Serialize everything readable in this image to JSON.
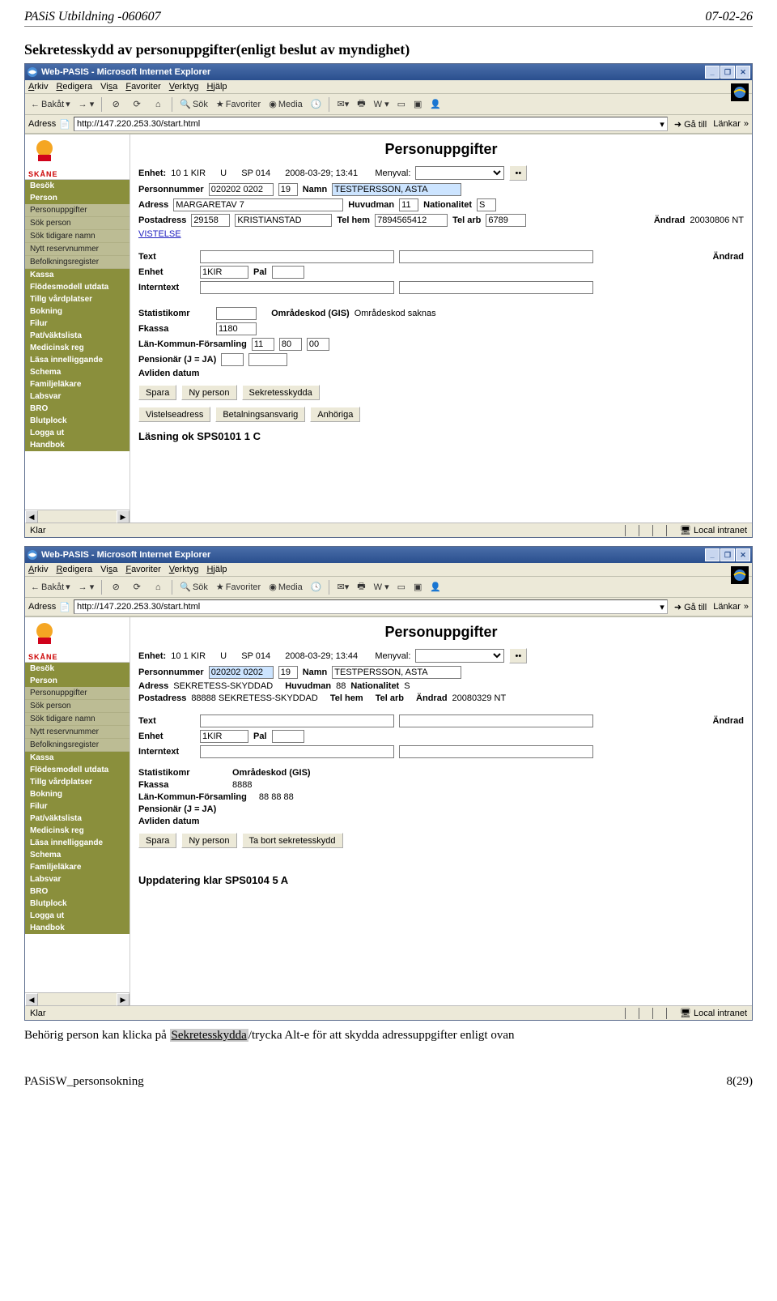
{
  "doc": {
    "header_left": "PASiS Utbildning -060607",
    "header_right": "07-02-26",
    "title": "Sekretesskydd av personuppgifter(enligt beslut av myndighet)",
    "body_1": "Behörig person kan klicka på ",
    "body_shaded": "Sekretesskydda",
    "body_2": "/trycka Alt-e för att skydda adressuppgifter enligt ovan",
    "footer_left": "PASiSW_personsokning",
    "footer_right": "8(29)"
  },
  "win1": {
    "title": "Web-PASIS - Microsoft Internet Explorer",
    "menu": [
      "Arkiv",
      "Redigera",
      "Visa",
      "Favoriter",
      "Verktyg",
      "Hjälp"
    ],
    "tb_back": "Bakåt",
    "tb_sok": "Sök",
    "tb_fav": "Favoriter",
    "tb_media": "Media",
    "addr_lbl": "Adress",
    "addr": "http://147.220.253.30/start.html",
    "go": "Gå till",
    "lankar": "Länkar",
    "logo": "SKÅNE",
    "nav_heads": [
      "Besök",
      "Person",
      "Kassa",
      "Flödesmodell utdata",
      "Tillg vårdplatser",
      "Bokning",
      "Filur",
      "Pat/väktslista",
      "Medicinsk reg",
      "Läsa innelliggande",
      "Schema",
      "Familjeläkare",
      "Labsvar",
      "BRO",
      "Blutplock",
      "Logga ut",
      "Handbok"
    ],
    "nav_items_person": [
      "Personuppgifter",
      "Sök person",
      "Sök tidigare namn",
      "Nytt reservnummer",
      "Befolkningsregister"
    ],
    "heading": "Personuppgifter",
    "enhet_lbl": "Enhet:",
    "enhet": "10 1 KIR",
    "enhet_u": "U",
    "sp": "SP 014",
    "dt": "2008-03-29; 13:41",
    "menyval": "Menyval:",
    "pn_lbl": "Personnummer",
    "pn": "020202 0202",
    "pn2": "19",
    "namn_lbl": "Namn",
    "namn": "TESTPERSSON, ASTA",
    "adr_lbl": "Adress",
    "adr": "MARGARETAV 7",
    "huvudman_lbl": "Huvudman",
    "huvudman": "11",
    "nat_lbl": "Nationalitet",
    "nat": "S",
    "post_lbl": "Postadress",
    "post1": "29158",
    "post2": "KRISTIANSTAD",
    "telhem_lbl": "Tel hem",
    "telhem": "7894565412",
    "telarb_lbl": "Tel arb",
    "telarb": "6789",
    "andrad_lbl": "Ändrad",
    "andrad": "20030806 NT",
    "vistelse": "VISTELSE",
    "text_lbl": "Text",
    "andrad2": "Ändrad",
    "enhet2_lbl": "Enhet",
    "enhet2": "1KIR",
    "pal_lbl": "Pal",
    "intern_lbl": "Interntext",
    "stat_lbl": "Statistikomr",
    "omr_lbl": "Områdeskod (GIS)",
    "omr_txt": "Områdeskod saknas",
    "fkassa_lbl": "Fkassa",
    "fkassa": "1180",
    "lkf_lbl": "Län-Kommun-Församling",
    "lkf1": "11",
    "lkf2": "80",
    "lkf3": "00",
    "pens_lbl": "Pensionär (J = JA)",
    "avl_lbl": "Avliden datum",
    "btn_spara": "Spara",
    "btn_ny": "Ny person",
    "btn_sekr": "Sekretesskydda",
    "btn_vist": "Vistelseadress",
    "btn_betal": "Betalningsansvarig",
    "btn_anh": "Anhöriga",
    "status": "Läsning ok SPS0101 1 C",
    "sb_left": "Klar",
    "sb_right": "Local intranet"
  },
  "win2": {
    "title": "Web-PASIS - Microsoft Internet Explorer",
    "heading": "Personuppgifter",
    "dt": "2008-03-29; 13:44",
    "pn_lbl": "Personnummer",
    "pn": "020202 0202",
    "pn2": "19",
    "namn_lbl": "Namn",
    "namn": "TESTPERSSON, ASTA",
    "adr_lbl": "Adress",
    "adr_txt": "SEKRETESS-SKYDDAD",
    "huvudman_lbl": "Huvudman",
    "huvudman": "88",
    "nat_lbl": "Nationalitet",
    "nat": "S",
    "post_lbl": "Postadress",
    "post_txt": "88888 SEKRETESS-SKYDDAD",
    "telhem_lbl": "Tel hem",
    "telarb_lbl": "Tel arb",
    "andrad_lbl": "Ändrad",
    "andrad": "20080329 NT",
    "text_lbl": "Text",
    "andrad2": "Ändrad",
    "enhet2_lbl": "Enhet",
    "enhet2": "1KIR",
    "pal_lbl": "Pal",
    "intern_lbl": "Interntext",
    "stat_lbl": "Statistikomr",
    "omr_lbl": "Områdeskod (GIS)",
    "fkassa_lbl": "Fkassa",
    "fkassa": "8888",
    "lkf_lbl": "Län-Kommun-Församling",
    "lkf": "88 88 88",
    "pens_lbl": "Pensionär (J = JA)",
    "avl_lbl": "Avliden datum",
    "btn_spara": "Spara",
    "btn_ny": "Ny person",
    "btn_tabort": "Ta bort sekretesskydd",
    "status": "Uppdatering klar SPS0104 5 A",
    "sb_left": "Klar",
    "sb_right": "Local intranet"
  }
}
